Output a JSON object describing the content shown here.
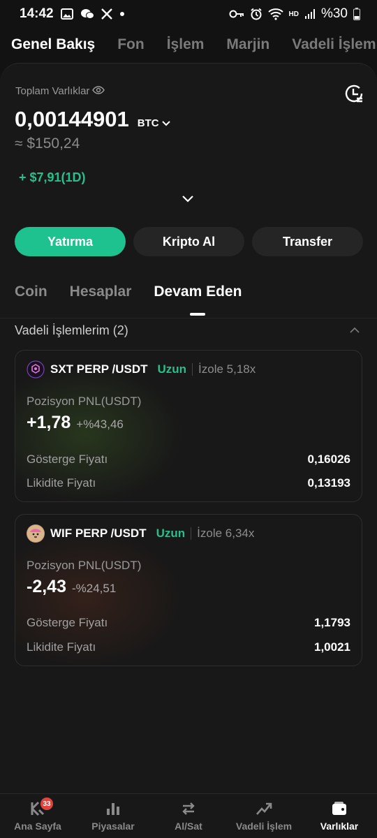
{
  "status_bar": {
    "time": "14:42",
    "battery": "%30",
    "network": "HD"
  },
  "top_tabs": [
    {
      "label": "Genel Bakış",
      "active": true
    },
    {
      "label": "Fon",
      "active": false
    },
    {
      "label": "İşlem",
      "active": false
    },
    {
      "label": "Marjin",
      "active": false
    },
    {
      "label": "Vadeli İşlem",
      "active": false
    }
  ],
  "summary": {
    "label": "Toplam Varlıklar",
    "balance": "0,00144901",
    "unit": "BTC",
    "approx": "≈ $150,24",
    "daily_pnl": "+ $7,91(1D)"
  },
  "actions": {
    "deposit": "Yatırma",
    "buy_crypto": "Kripto Al",
    "transfer": "Transfer"
  },
  "sub_tabs": [
    {
      "label": "Coin",
      "active": false
    },
    {
      "label": "Hesaplar",
      "active": false
    },
    {
      "label": "Devam Eden",
      "active": true
    }
  ],
  "section": {
    "title": "Vadeli İşlemlerim (2)"
  },
  "positions": [
    {
      "pair": "SXT PERP /USDT",
      "side": "Uzun",
      "leverage": "İzole 5,18x",
      "pnl_label": "Pozisyon PNL(USDT)",
      "pnl": "+1,78",
      "pnl_pct": "+%43,46",
      "mark_label": "Gösterge Fiyatı",
      "mark_price": "0,16026",
      "liq_label": "Likidite Fiyatı",
      "liq_price": "0,13193"
    },
    {
      "pair": "WIF PERP /USDT",
      "side": "Uzun",
      "leverage": "İzole 6,34x",
      "pnl_label": "Pozisyon PNL(USDT)",
      "pnl": "-2,43",
      "pnl_pct": "-%24,51",
      "mark_label": "Gösterge Fiyatı",
      "mark_price": "1,1793",
      "liq_label": "Likidite Fiyatı",
      "liq_price": "1,0021"
    }
  ],
  "bottom_nav": {
    "items": [
      {
        "label": "Ana Sayfa",
        "icon": "home-k-icon",
        "badge": "33"
      },
      {
        "label": "Piyasalar",
        "icon": "bar-chart-icon"
      },
      {
        "label": "Al/Sat",
        "icon": "swap-arrows-icon"
      },
      {
        "label": "Vadeli İşlem",
        "icon": "trend-up-icon"
      },
      {
        "label": "Varlıklar",
        "icon": "wallet-icon",
        "active": true
      }
    ]
  },
  "colors": {
    "accent_green": "#1dc28f",
    "profit_green": "#27c08a",
    "badge_red": "#e0443e",
    "background": "#121212"
  }
}
